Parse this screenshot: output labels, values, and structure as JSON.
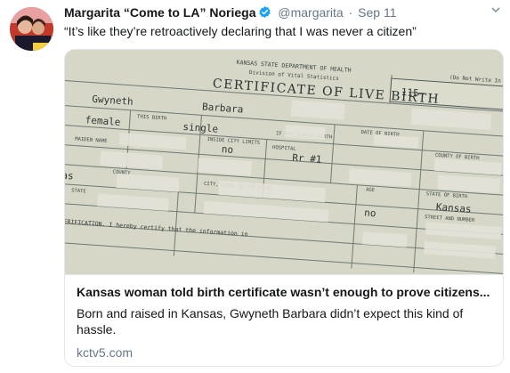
{
  "tweet": {
    "display_name": "Margarita “Come to LA” Noriega",
    "handle": "@margarita",
    "separator": "·",
    "date": "Sep 11",
    "text": "“It’s like they’re retroactively declaring that I was never a citizen”",
    "avatar_icon": "user-avatar",
    "verified_icon": "verified-badge-icon",
    "menu_icon": "chevron-down-icon",
    "colors": {
      "verified": "#1da1f2",
      "secondary_text": "#657786",
      "border": "#e1e8ed"
    }
  },
  "card": {
    "title": "Kansas woman told birth certificate wasn’t enough to prove citizens...",
    "description": "Born and raised in Kansas, Gwyneth Barbara didn’t expect this kind of hassle.",
    "domain": "kctv5.com",
    "image": {
      "header_state": "KANSAS STATE DEPARTMENT OF HEALTH",
      "header_division": "Division of Vital Statistics",
      "doc_title": "CERTIFICATE OF LIVE BIRTH",
      "file_number": "115–",
      "first_name": "Gwyneth",
      "middle_name": "Barbara",
      "sex": "female",
      "birth_type": "single",
      "inside_city": "no",
      "address_num": "Rr #1",
      "county": "as",
      "state": "Kansas",
      "inside_city_2": "no",
      "corner_note": "(Do Not Write In This",
      "label_1": "THIS BIRTH",
      "label_2": "DATE OF BIRTH",
      "label_3": "COUNTY OF BIRTH",
      "label_4": "HOSPITAL",
      "label_5": "CITY, TOWN, OR LOCATION",
      "label_6": "STATE OF BIRTH",
      "label_7": "STREET AND NUMBER",
      "label_8": "VERIFICATION. I hereby certify that the information in",
      "label_9": "COUNTY",
      "label_10": "MAIDEN NAME",
      "label_11": "IF NOT SINGLE BIRTH",
      "label_12": "AGE",
      "label_13": "INSIDE CITY LIMITS",
      "label_14": "STATE"
    }
  }
}
